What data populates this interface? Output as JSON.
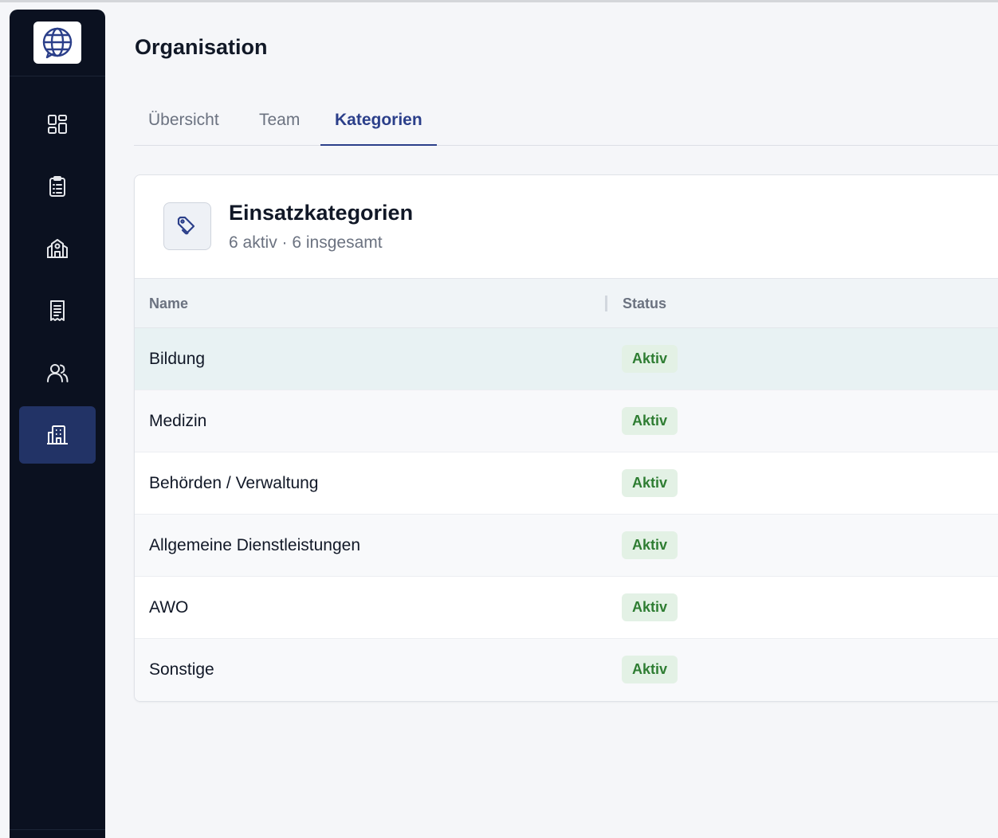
{
  "sidebar": {
    "logo_icon": "globe-chat-icon",
    "items": [
      {
        "icon": "dashboard-grid-icon",
        "active": false
      },
      {
        "icon": "clipboard-list-icon",
        "active": false
      },
      {
        "icon": "school-building-icon",
        "active": false
      },
      {
        "icon": "receipt-icon",
        "active": false
      },
      {
        "icon": "users-icon",
        "active": false
      },
      {
        "icon": "office-building-icon",
        "active": true
      }
    ]
  },
  "page": {
    "title": "Organisation"
  },
  "tabs": [
    {
      "label": "Übersicht",
      "active": false
    },
    {
      "label": "Team",
      "active": false
    },
    {
      "label": "Kategorien",
      "active": true
    }
  ],
  "card": {
    "icon": "tag-icon",
    "title": "Einsatzkategorien",
    "subtitle": "6 aktiv · 6 insgesamt",
    "columns": {
      "name": "Name",
      "status": "Status"
    },
    "rows": [
      {
        "name": "Bildung",
        "status": "Aktiv"
      },
      {
        "name": "Medizin",
        "status": "Aktiv"
      },
      {
        "name": "Behörden / Verwaltung",
        "status": "Aktiv"
      },
      {
        "name": "Allgemeine Dienstleistungen",
        "status": "Aktiv"
      },
      {
        "name": "AWO",
        "status": "Aktiv"
      },
      {
        "name": "Sonstige",
        "status": "Aktiv"
      }
    ]
  },
  "colors": {
    "sidebar_bg": "#0b1120",
    "accent": "#2b3f8a",
    "active_nav": "#223366",
    "badge_bg": "#e3f1e5",
    "badge_text": "#2e7d32"
  }
}
